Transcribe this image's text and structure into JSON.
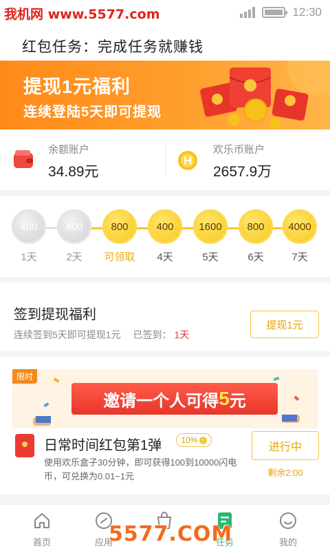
{
  "status_bar": {
    "watermark": "我机网 www.5577.com",
    "time": "12:30",
    "icons": [
      "signal-icon",
      "battery-icon"
    ]
  },
  "header": {
    "title": "红包任务：完成任务就赚钱"
  },
  "banner": {
    "line1": "提现1元福利",
    "line2": "连续登陆5天即可提现",
    "colors": {
      "start": "#ff8a1a",
      "end": "#ffb54a"
    }
  },
  "accounts": {
    "balance": {
      "label": "余额账户",
      "value": "34.89元",
      "icon": "wallet-icon"
    },
    "coins": {
      "label": "欢乐币账户",
      "value": "2657.9万",
      "icon": "coin-icon"
    }
  },
  "checkin_days": [
    {
      "amount": "400",
      "label": "1天",
      "state": "claimed"
    },
    {
      "amount": "400",
      "label": "2天",
      "state": "claimed"
    },
    {
      "amount": "800",
      "label": "可领取",
      "state": "available"
    },
    {
      "amount": "400",
      "label": "4天",
      "state": "upcoming"
    },
    {
      "amount": "1600",
      "label": "5天",
      "state": "upcoming"
    },
    {
      "amount": "800",
      "label": "6天",
      "state": "upcoming"
    },
    {
      "amount": "4000",
      "label": "7天",
      "state": "upcoming"
    }
  ],
  "checkin_card": {
    "title": "签到提现福利",
    "desc": "连续签到5天即可提现1元",
    "signed_label": "已签到：",
    "signed_value": "1天",
    "button": "提现1元"
  },
  "invite_banner": {
    "tag": "限时",
    "text_prefix": "邀请一个人可得",
    "text_amount": "5",
    "text_suffix": "元"
  },
  "task": {
    "title": "日常时间红包第1弹",
    "badge": "10%",
    "desc": "使用欢乐盒子30分钟，即可获得100到10000闪电币，可兑换为0.01~1元",
    "button": "进行中",
    "remaining": "剩余2:00"
  },
  "tabbar": [
    {
      "label": "首页",
      "icon": "home-icon",
      "active": false
    },
    {
      "label": "应用",
      "icon": "apps-icon",
      "active": false
    },
    {
      "label": "",
      "icon": "bag-icon",
      "active": false
    },
    {
      "label": "任务",
      "icon": "task-icon",
      "active": true
    },
    {
      "label": "我的",
      "icon": "profile-icon",
      "active": false
    }
  ],
  "bottom_watermark": "5577.COM",
  "colors": {
    "accent": "#f5c828",
    "button_text": "#e9a400",
    "tab_active": "#2bb673",
    "red": "#e33"
  }
}
